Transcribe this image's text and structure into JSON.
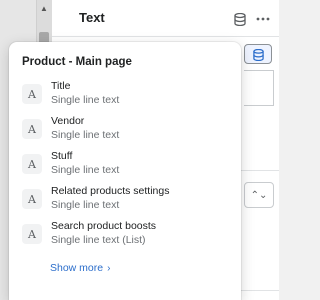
{
  "header": {
    "title": "Text",
    "more_icon": "more-horizontal-icon",
    "metafield_icon": "database-icon"
  },
  "popover": {
    "title": "Product - Main page",
    "items": [
      {
        "name": "Title",
        "type": "Single line text",
        "icon": "text-type-icon",
        "glyph": "A"
      },
      {
        "name": "Vendor",
        "type": "Single line text",
        "icon": "text-type-icon",
        "glyph": "A"
      },
      {
        "name": "Stuff",
        "type": "Single line text",
        "icon": "text-type-icon",
        "glyph": "A"
      },
      {
        "name": "Related products settings",
        "type": "Single line text",
        "icon": "text-type-icon",
        "glyph": "A"
      },
      {
        "name": "Search product boosts",
        "type": "Single line text (List)",
        "icon": "text-type-icon",
        "glyph": "A"
      }
    ],
    "show_more_label": "Show more"
  },
  "colors": {
    "link": "#2c6ecb",
    "accent_field": "#eef3ff"
  }
}
